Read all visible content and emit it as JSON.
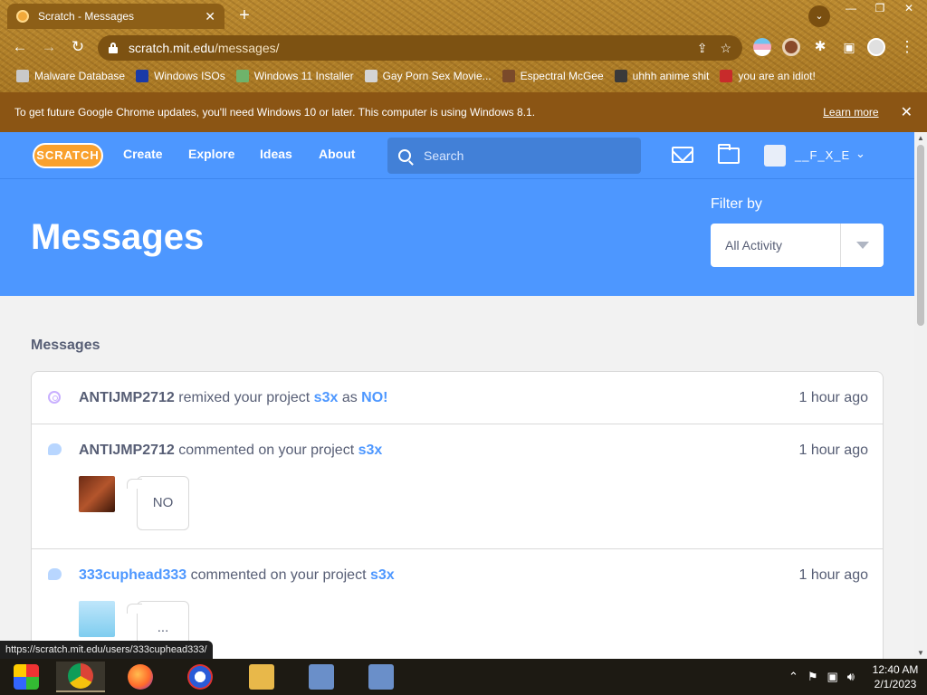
{
  "browser": {
    "tab_title": "Scratch - Messages",
    "url_host": "scratch.mit.edu",
    "url_path": "/messages/",
    "bookmarks": [
      {
        "label": "Malware Database",
        "color": "#c9c9c9"
      },
      {
        "label": "Windows ISOs",
        "color": "#1a3aa8"
      },
      {
        "label": "Windows 11 Installer",
        "color": "#6fb36b"
      },
      {
        "label": "Gay Porn Sex Movie...",
        "color": "#d4d4d4"
      },
      {
        "label": "Espectral McGee",
        "color": "#7a4a2a"
      },
      {
        "label": "uhhh anime shit",
        "color": "#3a3a3a"
      },
      {
        "label": "you are an idiot!",
        "color": "#c82b2b"
      }
    ],
    "infobar_message": "To get future Google Chrome updates, you'll need Windows 10 or later. This computer is using Windows 8.1.",
    "infobar_link": "Learn more",
    "status_url": "https://scratch.mit.edu/users/333cuphead333/"
  },
  "scratch": {
    "logo": "SCRATCH",
    "nav": [
      "Create",
      "Explore",
      "Ideas",
      "About"
    ],
    "search_placeholder": "Search",
    "username": "__F_X_E",
    "page_title": "Messages",
    "filter_label": "Filter by",
    "filter_value": "All Activity",
    "section_title": "Messages",
    "messages": [
      {
        "user": "ANTIJMP2712",
        "action": " remixed your project ",
        "project": "s3x",
        "extra_connector": " as ",
        "extra": "NO!",
        "time": "1 hour ago"
      },
      {
        "user": "ANTIJMP2712",
        "action": " commented on your project ",
        "project": "s3x",
        "time": "1 hour ago",
        "comment": "NO"
      },
      {
        "user": "333cuphead333",
        "action": " commented on your project ",
        "project": "s3x",
        "time": "1 hour ago",
        "comment": "..."
      }
    ]
  },
  "taskbar": {
    "time": "12:40 AM",
    "date": "2/1/2023"
  },
  "colors": {
    "scratch_blue": "#4d97ff",
    "chrome_theme": "#b5852d",
    "infobar": "#8b5514"
  }
}
